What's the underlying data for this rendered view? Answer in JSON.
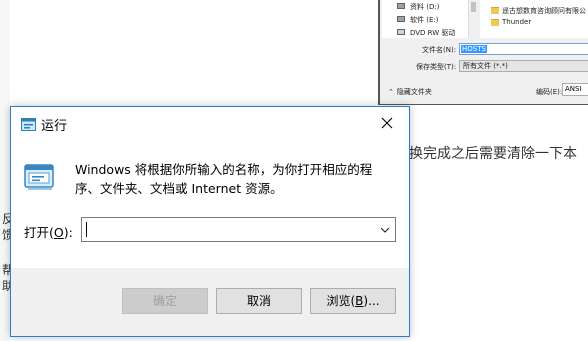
{
  "background": {
    "caption": "换完成之后需要清除一下本",
    "left_fragments": [
      "反",
      "馈",
      "帮",
      "助"
    ]
  },
  "save_dialog": {
    "tree_items": [
      "资料 (D:)",
      "软件 (E:)",
      "DVD RW 驱动"
    ],
    "files": [
      "遥古想数育咨询顾问有限公",
      "Thunder"
    ],
    "filename_label": "文件名(N):",
    "filename_value": "HOSTS",
    "filetype_label": "保存类型(T):",
    "filetype_value": "所有文件 (*.*)",
    "hide_folders": "隐藏文件夹",
    "encoding_label": "编码(E):",
    "encoding_value": "ANSI"
  },
  "run_dialog": {
    "title": "运行",
    "description": "Windows 将根据你所输入的名称，为你打开相应的程序、文件夹、文档或 Internet 资源。",
    "open_label_text": "打开(",
    "open_label_key": "O",
    "open_label_tail": "):",
    "input_value": "",
    "buttons": {
      "ok": "确定",
      "cancel": "取消",
      "browse_text": "浏览(",
      "browse_key": "B",
      "browse_tail": ")..."
    }
  },
  "colors": {
    "accent_border": "#2b7cd3",
    "selection": "#3399ff",
    "footer_bg": "#f0f0f0"
  },
  "icons": [
    "run-app-icon",
    "close-icon",
    "chevron-down-icon",
    "folder-icon",
    "drive-icon",
    "chevron-up-icon"
  ]
}
